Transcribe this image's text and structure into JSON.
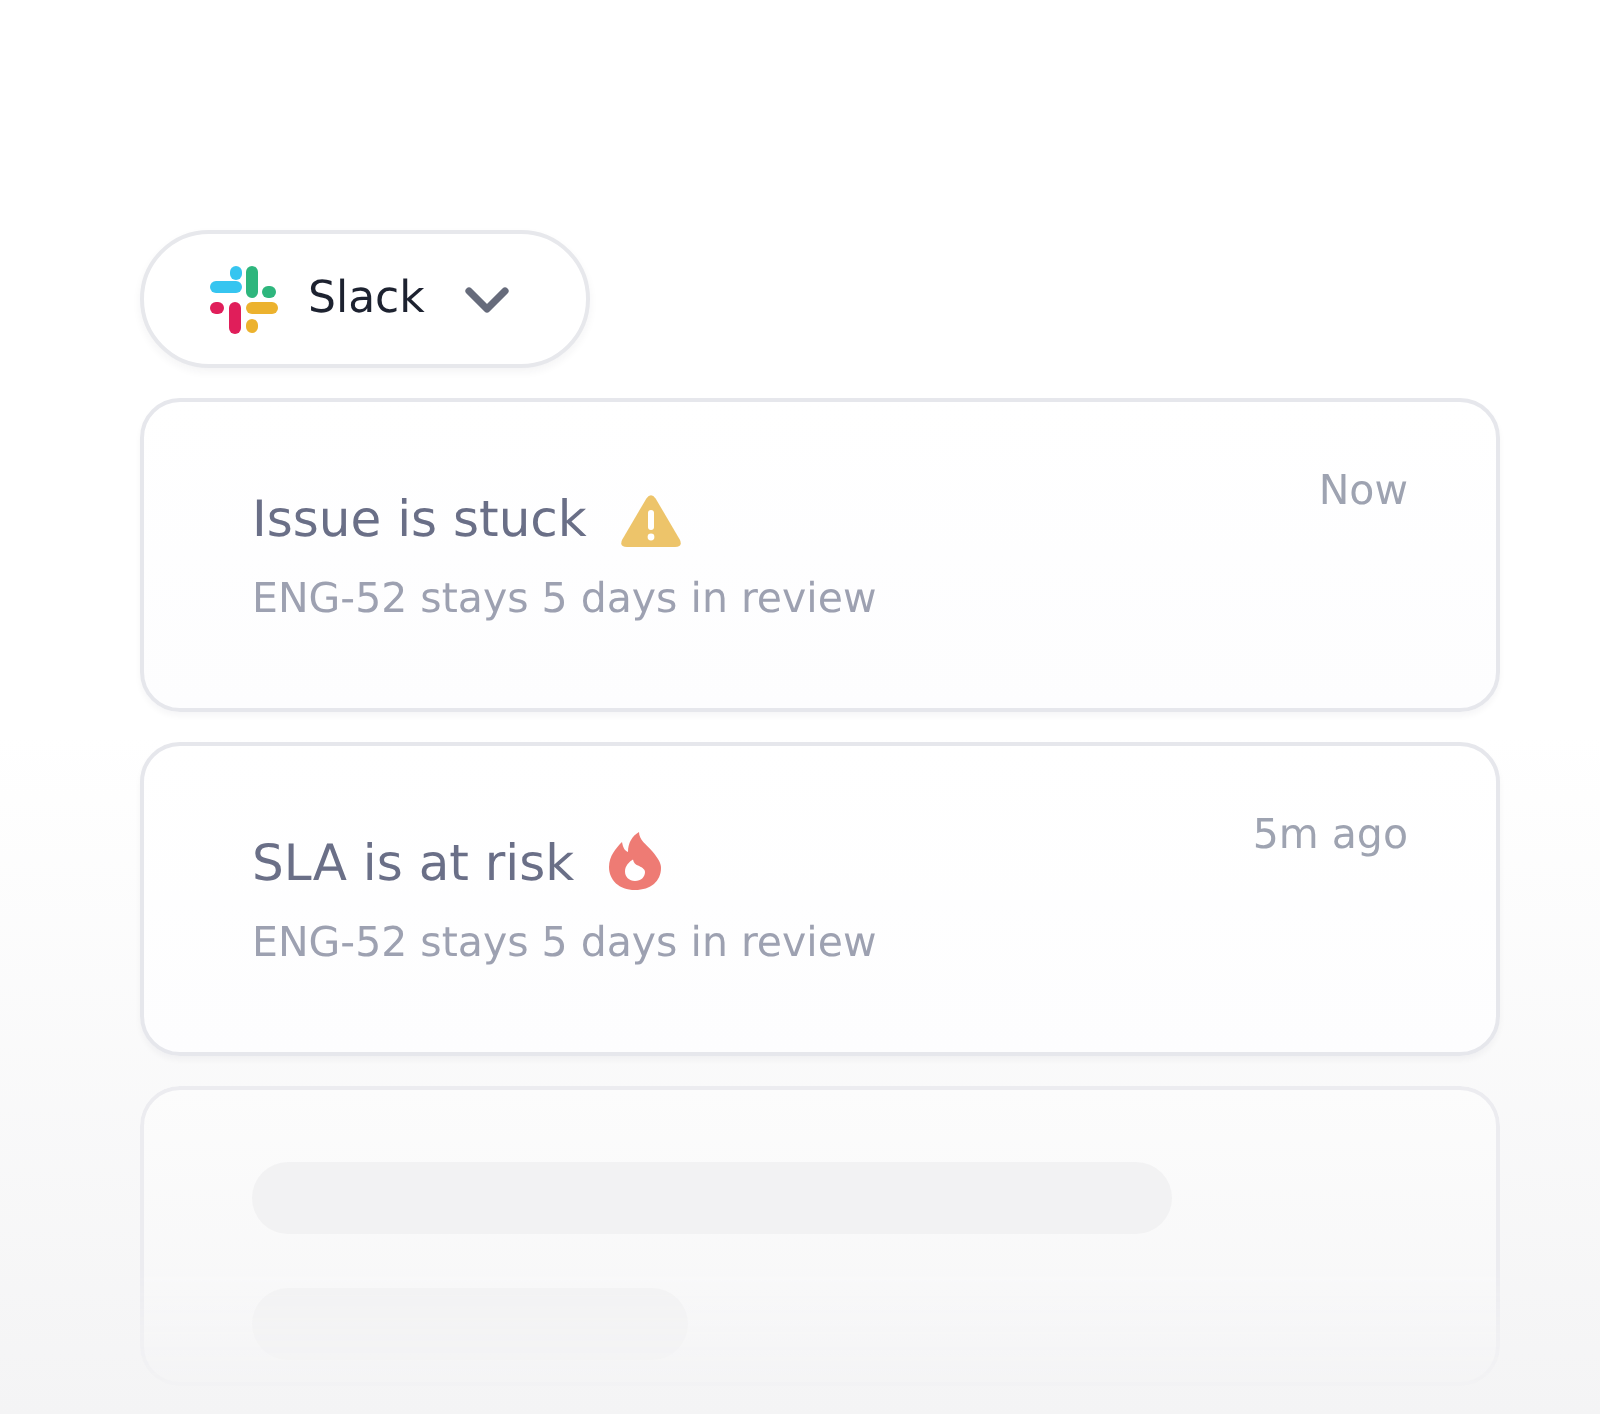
{
  "app_switcher": {
    "label": "Slack"
  },
  "notifications": [
    {
      "kind": "warning",
      "title": "Issue is stuck",
      "detail": "ENG-52 stays 5 days in review",
      "time": "Now"
    },
    {
      "kind": "risk",
      "title": "SLA is at risk",
      "detail": "ENG-52 stays 5 days in review",
      "time": "5m ago"
    },
    {
      "kind": "loading"
    }
  ]
}
